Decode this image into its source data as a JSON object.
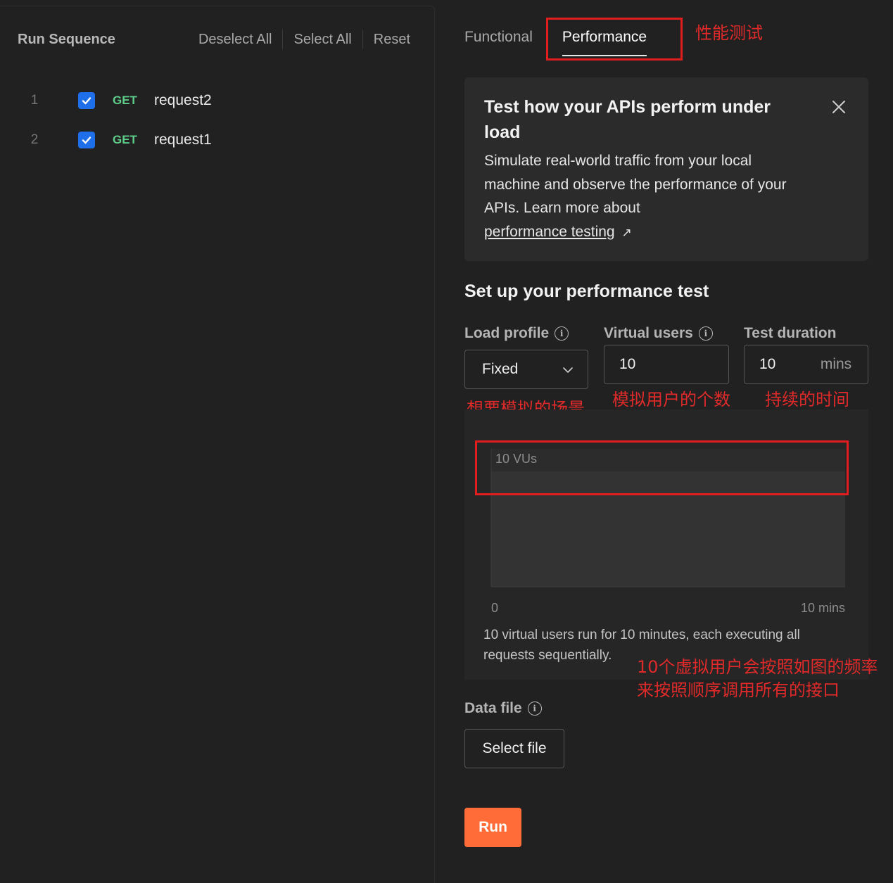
{
  "run_sequence": {
    "title": "Run Sequence",
    "actions": [
      "Deselect All",
      "Select All",
      "Reset"
    ],
    "requests": [
      {
        "index": "1",
        "method": "GET",
        "name": "request2",
        "checked": true
      },
      {
        "index": "2",
        "method": "GET",
        "name": "request1",
        "checked": true
      }
    ]
  },
  "tabs": [
    "Functional",
    "Performance"
  ],
  "active_tab": "Performance",
  "info_card": {
    "title": "Test how your APIs perform under load",
    "body": "Simulate real-world traffic from your local machine and observe the performance of your APIs. Learn more about",
    "link": "performance testing",
    "link_arrow": "↗"
  },
  "setup": {
    "title": "Set up your performance test",
    "load_profile": {
      "label": "Load profile",
      "value": "Fixed"
    },
    "virtual_users": {
      "label": "Virtual users",
      "value": "10"
    },
    "test_duration": {
      "label": "Test duration",
      "value": "10",
      "unit": "mins"
    }
  },
  "chart": {
    "y_label": "10 VUs",
    "x_start": "0",
    "x_end": "10 mins",
    "description": "10 virtual users run for 10 minutes, each executing all requests sequentially."
  },
  "chart_data": {
    "type": "area",
    "x": [
      0,
      10
    ],
    "y": [
      10,
      10
    ],
    "xlabel": "",
    "ylabel": "",
    "x_tick_labels": [
      "0",
      "10 mins"
    ],
    "y_tick_labels": [
      "10 VUs"
    ],
    "xlim": [
      0,
      10
    ],
    "ylim": [
      0,
      10
    ]
  },
  "data_file": {
    "label": "Data file",
    "button": "Select file"
  },
  "run_button": "Run",
  "annotations": {
    "performance": "性能测试",
    "load_profile": "想要模拟的场景",
    "virtual_users": "模拟用户的个数",
    "duration": "持续的时间",
    "chart_line1": "10个虚拟用户会按照如图的频率",
    "chart_line2": "来按照顺序调用所有的接口"
  },
  "colors": {
    "background": "#212121",
    "accent_blue": "#1f6feb",
    "get_green": "#5fcc8a",
    "run_orange": "#ff6c37",
    "annotation_red": "#e01e1e"
  }
}
